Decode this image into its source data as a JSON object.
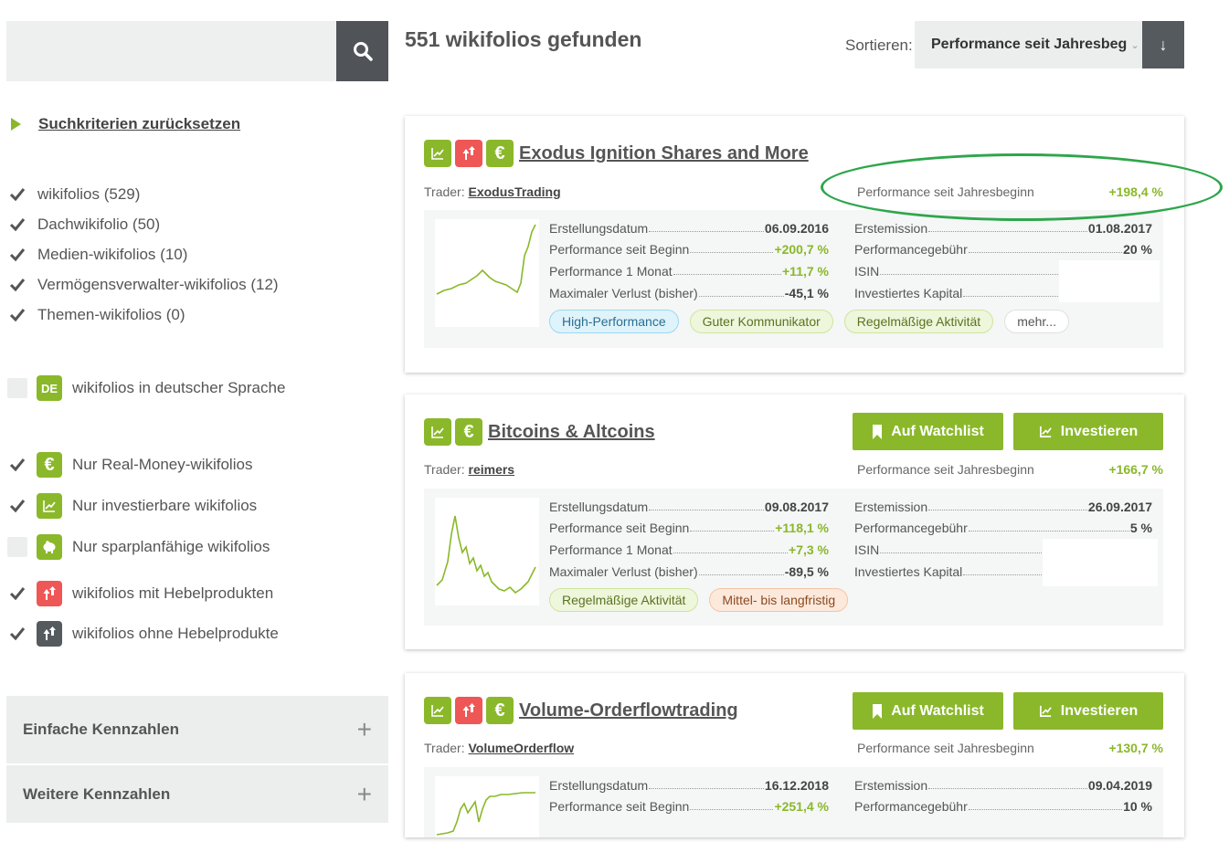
{
  "search": {
    "placeholder": ""
  },
  "reset_label": "Suchkriterien zurücksetzen",
  "categories": [
    {
      "label": "wikifolios (529)",
      "checked": true
    },
    {
      "label": "Dachwikifolio (50)",
      "checked": true
    },
    {
      "label": "Medien-wikifolios (10)",
      "checked": true
    },
    {
      "label": "Vermögensverwalter-wikifolios (12)",
      "checked": true
    },
    {
      "label": "Themen-wikifolios (0)",
      "checked": true
    }
  ],
  "filters": {
    "language": {
      "badge": "DE",
      "label": "wikifolios in deutscher Sprache",
      "checked": false
    },
    "real_money": {
      "label": "Nur Real-Money-wikifolios",
      "checked": true
    },
    "investable": {
      "label": "Nur investierbare wikifolios",
      "checked": true
    },
    "savings_plan": {
      "label": "Nur sparplanfähige wikifolios",
      "checked": false
    },
    "with_leverage": {
      "label": "wikifolios mit Hebelprodukten",
      "checked": true
    },
    "without_leverage": {
      "label": "wikifolios ohne Hebelprodukte",
      "checked": true
    }
  },
  "accordion": {
    "simple": "Einfache Kennzahlen",
    "more": "Weitere Kennzahlen",
    "plus": "+"
  },
  "header": {
    "result_count": "551 wikifolios gefunden",
    "sort_label": "Sortieren:",
    "sort_value": "Performance seit Jahresbeg",
    "sort_dir": "↓"
  },
  "labels": {
    "trader_prefix": "Trader:",
    "perf_ytd": "Performance seit Jahresbeginn",
    "created": "Erstellungsdatum",
    "perf_since_start": "Performance seit Beginn",
    "perf_1m": "Performance 1 Monat",
    "max_loss": "Maximaler Verlust (bisher)",
    "issue": "Erstemission",
    "fee": "Performancegebühr",
    "isin": "ISIN",
    "capital": "Investiertes Kapital",
    "watchlist": "Auf Watchlist",
    "invest": "Investieren"
  },
  "cards": [
    {
      "title": "Exodus Ignition Shares and More",
      "trader": "ExodusTrading",
      "perf_ytd": "+198,4 %",
      "created": "06.09.2016",
      "perf_since_start": "+200,7 %",
      "perf_1m": "+11,7 %",
      "max_loss": "-45,1 %",
      "issue": "01.08.2017",
      "fee": "20 %",
      "tags": [
        "High-Performance",
        "Guter Kommunikator",
        "Regelmäßige Aktivität",
        "mehr..."
      ]
    },
    {
      "title": "Bitcoins & Altcoins",
      "trader": "reimers",
      "perf_ytd": "+166,7 %",
      "created": "09.08.2017",
      "perf_since_start": "+118,1 %",
      "perf_1m": "+7,3 %",
      "max_loss": "-89,5 %",
      "issue": "26.09.2017",
      "fee": "5 %",
      "tags": [
        "Regelmäßige Aktivität",
        "Mittel- bis langfristig"
      ]
    },
    {
      "title": "Volume-Orderflowtrading",
      "trader": "VolumeOrderflow",
      "perf_ytd": "+130,7 %",
      "created": "16.12.2018",
      "perf_since_start": "+251,4 %",
      "issue": "09.04.2019",
      "fee": "10 %"
    }
  ],
  "colors": {
    "accent_green": "#8ab82a",
    "leverage_red": "#ef5656",
    "highlight_ellipse": "#2ea64b"
  }
}
